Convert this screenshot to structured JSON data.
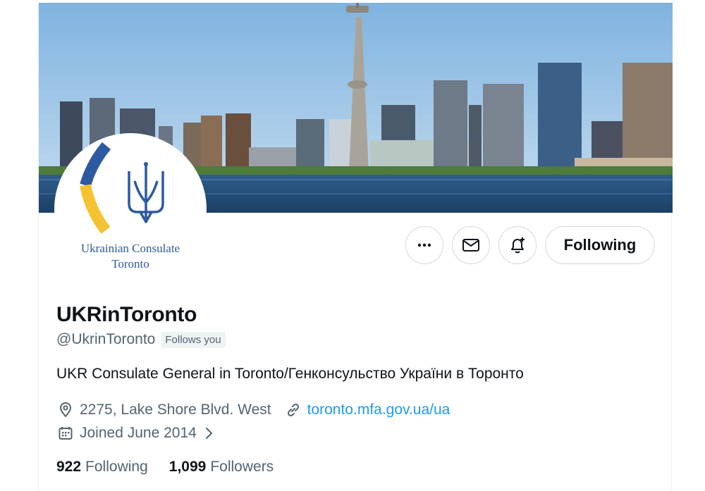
{
  "profile": {
    "display_name": "UKRinToronto",
    "handle": "@UkrinToronto",
    "follows_you_badge": "Follows you",
    "bio": "UKR Consulate General in Toronto/Генконсульство України в Торонто",
    "location": "2275, Lake Shore Blvd. West",
    "website": "toronto.mfa.gov.ua/ua",
    "joined": "Joined June 2014"
  },
  "avatar": {
    "line1": "Ukrainian Consulate",
    "line2": "Toronto"
  },
  "actions": {
    "more_icon": "ellipsis-icon",
    "message_icon": "envelope-icon",
    "notify_icon": "bell-plus-icon",
    "follow_label": "Following"
  },
  "stats": {
    "following_count": "922",
    "following_label": "Following",
    "followers_count": "1,099",
    "followers_label": "Followers"
  },
  "icons": {
    "location": "location-pin-icon",
    "link": "link-icon",
    "calendar": "calendar-icon",
    "chevron": "chevron-right-icon"
  },
  "colors": {
    "link": "#1d9bf0",
    "secondary_text": "#536471",
    "primary_text": "#0f1419",
    "ukraine_blue": "#2c5aa0",
    "ukraine_yellow": "#f5c231"
  }
}
